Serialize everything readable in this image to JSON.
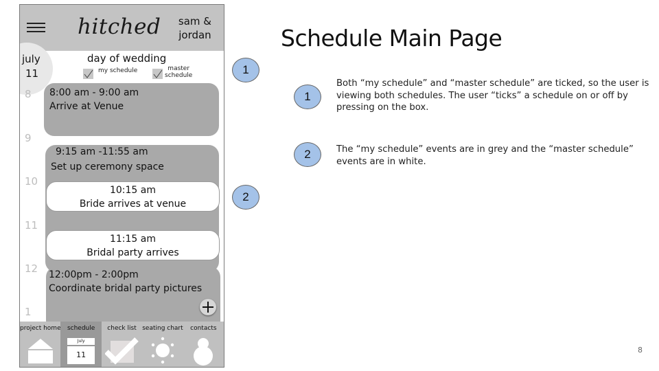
{
  "slide": {
    "title": "Schedule Main Page",
    "page_number": "8",
    "annotations": [
      {
        "number": "1",
        "text": "Both “my schedule” and “master schedule” are ticked, so the user is viewing both schedules. The user “ticks” a schedule on or off by pressing on the box."
      },
      {
        "number": "2",
        "text": "The “my schedule” events are in grey and the “master schedule” events are in white."
      }
    ],
    "badge_color": "#a4c2e8"
  },
  "app": {
    "header": {
      "menu_icon": "hamburger-menu-icon",
      "logo": "hitched",
      "couple_line1": "sam &",
      "couple_line2": "jordan"
    },
    "date": {
      "month": "july",
      "day": "11"
    },
    "day_title": "day of wedding",
    "filters": [
      {
        "label": "my schedule",
        "checked": true
      },
      {
        "label_line1": "master",
        "label_line2": "schedule",
        "checked": true
      }
    ],
    "hours": [
      "8",
      "9",
      "10",
      "11",
      "12",
      "1"
    ],
    "events": [
      {
        "time": "8:00 am - 9:00 am",
        "title": "Arrive at Venue",
        "type": "my schedule"
      },
      {
        "time": "9:15 am -11:55 am",
        "title": "Set up ceremony space",
        "type": "my schedule"
      },
      {
        "time": "10:15 am",
        "title": "Bride arrives at venue",
        "type": "master schedule"
      },
      {
        "time": "11:15 am",
        "title": "Bridal party arrives",
        "type": "master schedule"
      },
      {
        "time": "12:00pm - 2:00pm",
        "title": "Coordinate bridal party pictures",
        "type": "my schedule"
      }
    ],
    "add_button_icon": "plus-icon",
    "colors": {
      "header": "#c3c3c3",
      "my_event": "#a9a9a9",
      "master_event": "#ffffff",
      "active_tab": "#999999"
    },
    "tabs": [
      {
        "label": "project home",
        "icon": "house-icon",
        "active": false
      },
      {
        "label": "schedule",
        "icon": "calendar-icon",
        "icon_month": "July",
        "icon_day": "11",
        "active": true
      },
      {
        "label": "check list",
        "icon": "checkmark-icon",
        "active": false
      },
      {
        "label": "seating chart",
        "icon": "table-seats-icon",
        "active": false
      },
      {
        "label": "contacts",
        "icon": "person-icon",
        "active": false
      }
    ]
  }
}
